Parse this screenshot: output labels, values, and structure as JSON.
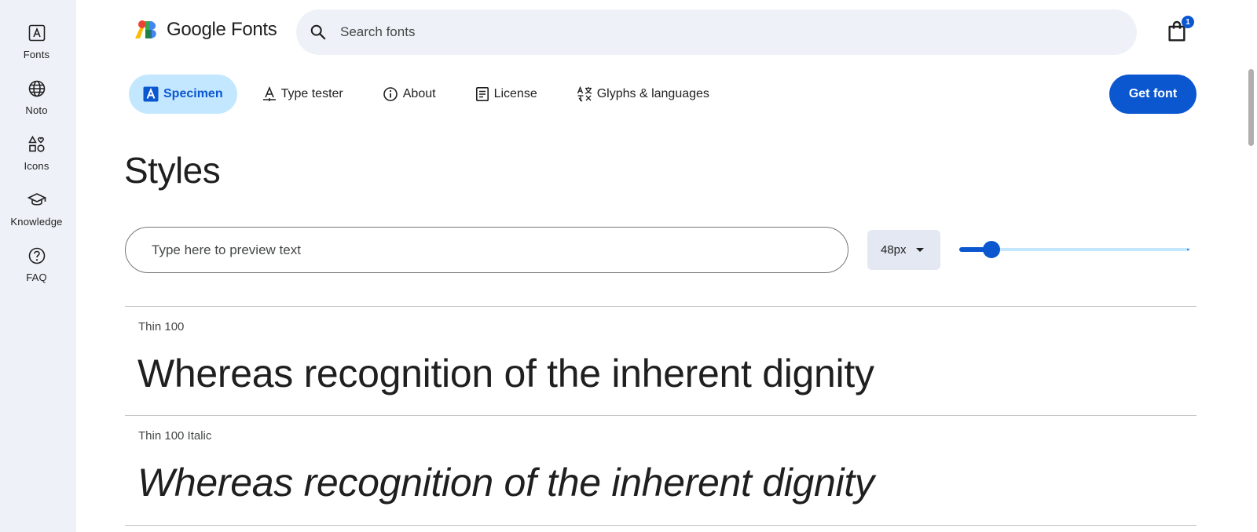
{
  "rail": {
    "items": [
      {
        "label": "Fonts",
        "icon": "font-a-icon"
      },
      {
        "label": "Noto",
        "icon": "globe-icon"
      },
      {
        "label": "Icons",
        "icon": "shapes-icon"
      },
      {
        "label": "Knowledge",
        "icon": "graduation-cap-icon"
      },
      {
        "label": "FAQ",
        "icon": "help-circle-icon"
      }
    ]
  },
  "header": {
    "logo_text": "Google Fonts",
    "search_placeholder": "Search fonts",
    "cart_count": "1"
  },
  "tabs": [
    {
      "label": "Specimen",
      "active": true
    },
    {
      "label": "Type tester",
      "active": false
    },
    {
      "label": "About",
      "active": false
    },
    {
      "label": "License",
      "active": false
    },
    {
      "label": "Glyphs & languages",
      "active": false
    }
  ],
  "get_font_label": "Get font",
  "styles": {
    "title": "Styles",
    "preview_placeholder": "Type here to preview text",
    "size_value": "48px",
    "size_slider_fraction": 0.14,
    "rows": [
      {
        "label": "Thin 100",
        "sample": "Whereas recognition of the inherent dignity",
        "italic": false
      },
      {
        "label": "Thin 100 Italic",
        "sample": "Whereas recognition of the inherent dignity",
        "italic": true
      }
    ]
  },
  "colors": {
    "accent": "#0b57d0",
    "accent_light": "#c2e7ff",
    "rail_bg": "#eef2f8"
  }
}
